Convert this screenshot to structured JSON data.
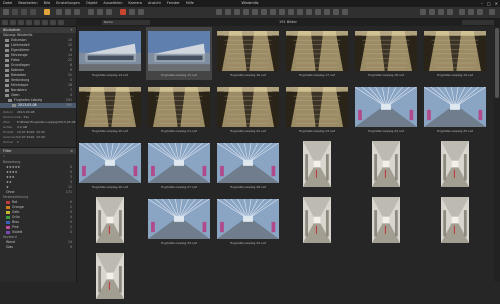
{
  "window": {
    "title": "Windmills",
    "menu": [
      "Datei",
      "Bearbeiten",
      "Bild",
      "Einstellungen",
      "Objekt",
      "Auswählen",
      "Kamera",
      "Ansicht",
      "Fenster",
      "Hilfe"
    ]
  },
  "browser": {
    "count_label": "191 Bilder",
    "sort_label": "Name"
  },
  "library": {
    "header": "Bibliothek",
    "sections": [
      "Sammlung",
      "Ordner"
    ],
    "session_label": "Sitzung: Windmills",
    "items": [
      {
        "label": "Exkursion",
        "count": "10"
      },
      {
        "label": "Lichtmodell",
        "count": "12"
      },
      {
        "label": "Eigentümer",
        "count": "8"
      },
      {
        "label": "Fahrzeuge",
        "count": "14"
      },
      {
        "label": "Fotos",
        "count": "22"
      },
      {
        "label": "Grundlagen",
        "count": "6"
      },
      {
        "label": "Kabinen",
        "count": "9"
      },
      {
        "label": "Rohdaten",
        "count": "31"
      },
      {
        "label": "Verbindung",
        "count": "5"
      },
      {
        "label": "Fahrtreppe",
        "count": "18"
      },
      {
        "label": "Nordstern",
        "count": "7"
      },
      {
        "label": "Oben",
        "count": "4"
      },
      {
        "label": "Flughafen Leipzig",
        "count": "191"
      },
      {
        "label": "2013-03-08",
        "count": "191"
      }
    ]
  },
  "metadata": {
    "rows": [
      {
        "k": "Datum",
        "v": "2013-03-08"
      },
      {
        "k": "Zeitraum",
        "v": "1s - 51s"
      },
      {
        "k": "Pfad",
        "v": "E:\\Bilder\\Flughafen Leipzig\\2013-03-08"
      },
      {
        "k": "Größe",
        "v": "3,2 GB"
      },
      {
        "k": "Erstellt",
        "v": "12.07.2016, 13:35"
      },
      {
        "k": "Geändert",
        "v": "12.07.2016, 13:40"
      },
      {
        "k": "Ordner",
        "v": "1"
      }
    ]
  },
  "filter": {
    "header": "Filter",
    "sub_rating": "Bewertung",
    "ratings": [
      {
        "label": "★★★★★",
        "count": "0"
      },
      {
        "label": "★★★★",
        "count": "0"
      },
      {
        "label": "★★★",
        "count": "3"
      },
      {
        "label": "★★",
        "count": "5"
      },
      {
        "label": "★",
        "count": "12"
      },
      {
        "label": "Ohne",
        "count": "171"
      }
    ],
    "sub_color": "Farbmarkierung",
    "colors": [
      {
        "label": "Rot",
        "count": "0",
        "hex": "#c23b3b"
      },
      {
        "label": "Orange",
        "count": "2",
        "hex": "#d07a26"
      },
      {
        "label": "Gelb",
        "count": "0",
        "hex": "#c9b52a"
      },
      {
        "label": "Grün",
        "count": "4",
        "hex": "#3c9a3c"
      },
      {
        "label": "Blau",
        "count": "0",
        "hex": "#3a62b8"
      },
      {
        "label": "Pink",
        "count": "1",
        "hex": "#c04aa0"
      },
      {
        "label": "Violett",
        "count": "0",
        "hex": "#7a4ab8"
      }
    ],
    "sub_tag": "Keyword",
    "tags": [
      {
        "label": "Wand",
        "count": "14"
      },
      {
        "label": "Glas",
        "count": "9"
      }
    ]
  },
  "thumbnails": [
    {
      "caption": "flughafen-leipzig-14.nef",
      "kind": "exterior"
    },
    {
      "caption": "flughafen-leipzig-15.nef",
      "kind": "exterior"
    },
    {
      "caption": "flughafen-leipzig-16.nef",
      "kind": "escalator"
    },
    {
      "caption": "flughafen-leipzig-17.nef",
      "kind": "escalator"
    },
    {
      "caption": "flughafen-leipzig-18.nef",
      "kind": "escalator"
    },
    {
      "caption": "flughafen-leipzig-19.nef",
      "kind": "escalator"
    },
    {
      "caption": "flughafen-leipzig-20.nef",
      "kind": "escalator"
    },
    {
      "caption": "flughafen-leipzig-21.nef",
      "kind": "escalator"
    },
    {
      "caption": "flughafen-leipzig-22.nef",
      "kind": "escalator"
    },
    {
      "caption": "flughafen-leipzig-23.nef",
      "kind": "escalator"
    },
    {
      "caption": "flughafen-leipzig-24.nef",
      "kind": "walkway"
    },
    {
      "caption": "flughafen-leipzig-25.nef",
      "kind": "walkway"
    },
    {
      "caption": "flughafen-leipzig-26.nef",
      "kind": "walkway"
    },
    {
      "caption": "flughafen-leipzig-27.nef",
      "kind": "walkway"
    },
    {
      "caption": "flughafen-leipzig-28.nef",
      "kind": "walkway"
    },
    {
      "caption": "flughafen-leipzig-29.nef",
      "kind": "corridor"
    },
    {
      "caption": "flughafen-leipzig-30.nef",
      "kind": "corridor"
    },
    {
      "caption": "flughafen-leipzig-31.nef",
      "kind": "corridor"
    },
    {
      "caption": "flughafen-leipzig-32.nef",
      "kind": "corridor"
    },
    {
      "caption": "flughafen-leipzig-33.nef",
      "kind": "walkway"
    },
    {
      "caption": "flughafen-leipzig-34.nef",
      "kind": "walkway"
    },
    {
      "caption": "flughafen-leipzig-35.nef",
      "kind": "corridor"
    },
    {
      "caption": "flughafen-leipzig-36.nef",
      "kind": "corridor"
    },
    {
      "caption": "flughafen-leipzig-37.nef",
      "kind": "corridor"
    },
    {
      "caption": "flughafen-leipzig-38.nef",
      "kind": "corridor"
    }
  ],
  "colors": {
    "background": "#262626",
    "panel": "#2b2b2b",
    "selection": "#4a5a6c",
    "accent": "#e3a43c"
  }
}
